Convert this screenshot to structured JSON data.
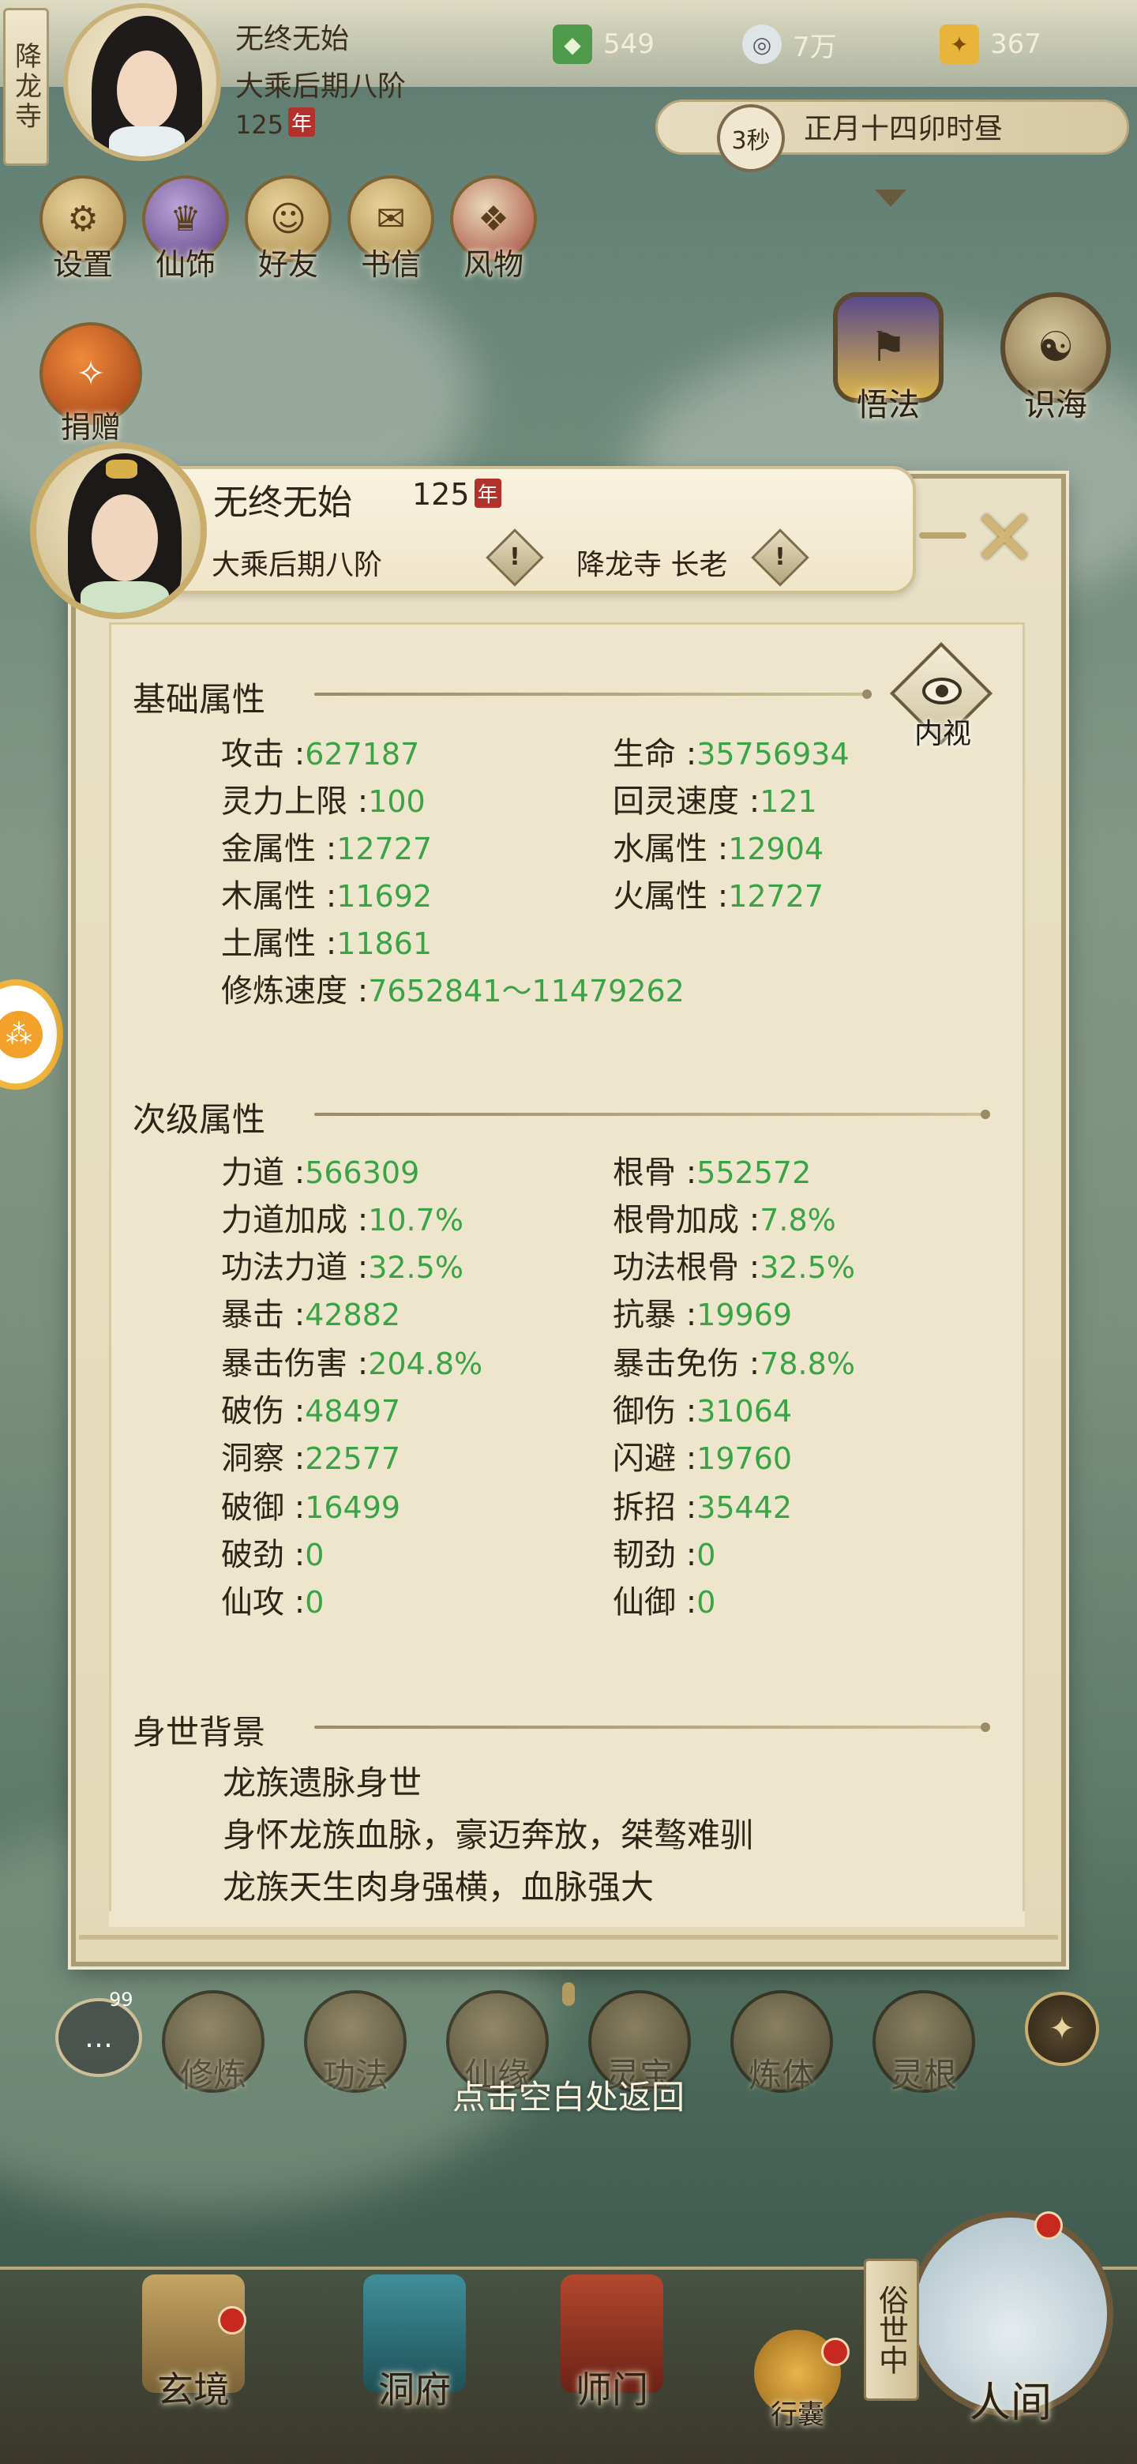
{
  "top_bar": {
    "location": "降龙寺",
    "player": {
      "name": "无终无始",
      "realm": "大乘后期八阶",
      "age": "125",
      "age_unit": "年"
    },
    "resources": [
      {
        "icon": "jade-icon",
        "value": "549"
      },
      {
        "icon": "coin-icon",
        "value": "7万"
      },
      {
        "icon": "strength-icon",
        "value": "367"
      }
    ],
    "timer": "3秒",
    "game_time": "正月十四卯时昼"
  },
  "menu": [
    {
      "label": "设置",
      "icon": "settings-icon"
    },
    {
      "label": "仙饰",
      "icon": "costume-icon"
    },
    {
      "label": "好友",
      "icon": "friends-icon"
    },
    {
      "label": "书信",
      "icon": "letter-icon"
    },
    {
      "label": "风物",
      "icon": "scenery-icon"
    }
  ],
  "side_buttons": {
    "donate": "捐赠",
    "enlighten": "悟法",
    "consciousness": "识海"
  },
  "profile": {
    "name": "无终无始",
    "age": "125",
    "age_unit": "年",
    "realm": "大乘后期八阶",
    "sect": "降龙寺 长老",
    "warn_symbol": "!",
    "close_symbol": "✕",
    "inspect_label": "内视",
    "basic_title": "基础属性",
    "basic_stats": [
      {
        "label": "攻击",
        "value": "627187"
      },
      {
        "label": "生命",
        "value": "35756934"
      },
      {
        "label": "灵力上限",
        "value": "100"
      },
      {
        "label": "回灵速度",
        "value": "121"
      },
      {
        "label": "金属性",
        "value": "12727"
      },
      {
        "label": "水属性",
        "value": "12904"
      },
      {
        "label": "木属性",
        "value": "11692"
      },
      {
        "label": "火属性",
        "value": "12727"
      },
      {
        "label": "土属性",
        "value": "11861"
      }
    ],
    "cultivation_speed": {
      "label": "修炼速度",
      "value": "7652841～11479262"
    },
    "secondary_title": "次级属性",
    "secondary_stats": [
      {
        "label": "力道",
        "value": "566309"
      },
      {
        "label": "根骨",
        "value": "552572"
      },
      {
        "label": "力道加成",
        "value": "10.7%"
      },
      {
        "label": "根骨加成",
        "value": "7.8%"
      },
      {
        "label": "功法力道",
        "value": "32.5%"
      },
      {
        "label": "功法根骨",
        "value": "32.5%"
      },
      {
        "label": "暴击",
        "value": "42882"
      },
      {
        "label": "抗暴",
        "value": "19969"
      },
      {
        "label": "暴击伤害",
        "value": "204.8%"
      },
      {
        "label": "暴击免伤",
        "value": "78.8%"
      },
      {
        "label": "破伤",
        "value": "48497"
      },
      {
        "label": "御伤",
        "value": "31064"
      },
      {
        "label": "洞察",
        "value": "22577"
      },
      {
        "label": "闪避",
        "value": "19760"
      },
      {
        "label": "破御",
        "value": "16499"
      },
      {
        "label": "拆招",
        "value": "35442"
      },
      {
        "label": "破劲",
        "value": "0"
      },
      {
        "label": "韧劲",
        "value": "0"
      },
      {
        "label": "仙攻",
        "value": "0"
      },
      {
        "label": "仙御",
        "value": "0"
      }
    ],
    "background_title": "身世背景",
    "background_lines": [
      "龙族遗脉身世",
      "身怀龙族血脉，豪迈奔放，桀骜难驯",
      "龙族天生肉身强横，血脉强大"
    ]
  },
  "bottom_icons": [
    {
      "label": "修炼"
    },
    {
      "label": "功法"
    },
    {
      "label": "仙缘"
    },
    {
      "label": "灵宝"
    },
    {
      "label": "炼体"
    },
    {
      "label": "灵根"
    }
  ],
  "chat_badge": "99",
  "return_hint": "点击空白处返回",
  "tabs": [
    {
      "label": "玄境"
    },
    {
      "label": "洞府"
    },
    {
      "label": "师门"
    },
    {
      "label": "行囊"
    },
    {
      "label": "人间"
    }
  ],
  "world_banner": "俗世中"
}
